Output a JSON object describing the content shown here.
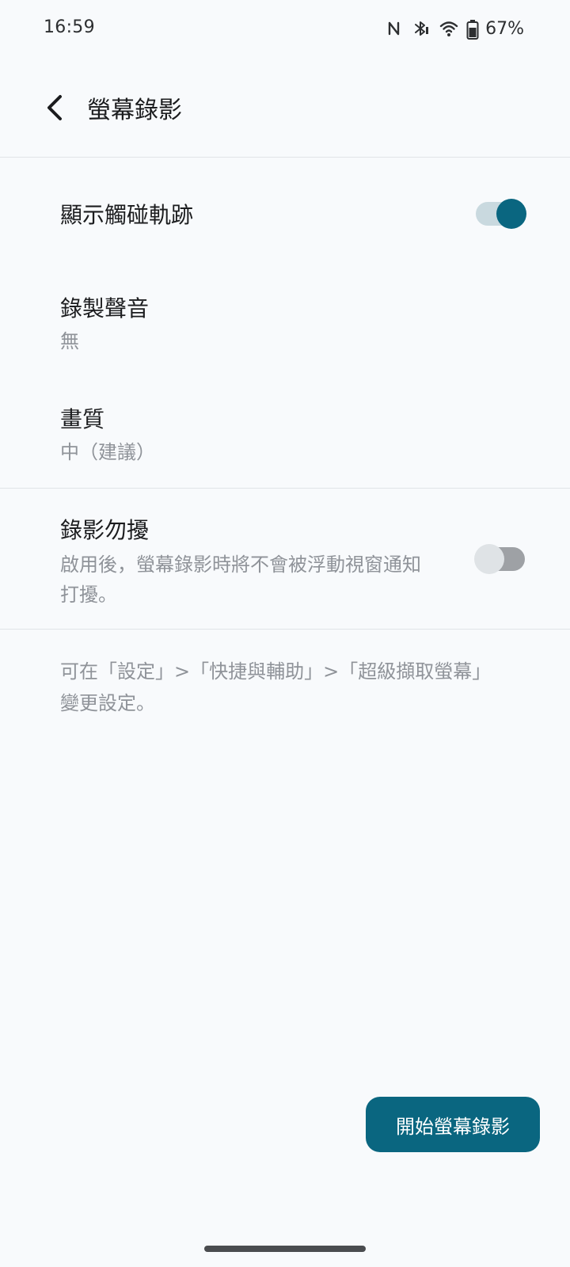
{
  "status_bar": {
    "time": "16:59",
    "battery_percent": "67%",
    "icons": [
      "nfc-icon",
      "bluetooth-icon",
      "wifi-icon",
      "battery-icon"
    ]
  },
  "app_bar": {
    "title": "螢幕錄影"
  },
  "settings": {
    "show_touches": {
      "title": "顯示觸碰軌跡",
      "enabled": true
    },
    "record_audio": {
      "title": "錄製聲音",
      "value": "無"
    },
    "quality": {
      "title": "畫質",
      "value": "中（建議）"
    },
    "dnd": {
      "title": "錄影勿擾",
      "description": "啟用後，螢幕錄影時將不會被浮動視窗通知打擾。",
      "enabled": false
    }
  },
  "footer_note": "可在「設定」>「快捷與輔助」>「超級擷取螢幕」變更設定。",
  "start_button": {
    "label": "開始螢幕錄影"
  },
  "colors": {
    "accent": "#0a6680",
    "background": "#f8fafc"
  }
}
